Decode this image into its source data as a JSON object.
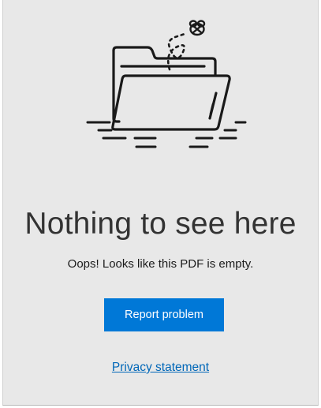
{
  "empty_state": {
    "illustration_icon": "empty-folder-with-bee-icon",
    "title": "Nothing to see here",
    "message": "Oops! Looks like this PDF is empty.",
    "report_button_label": "Report problem",
    "privacy_link_label": "Privacy statement"
  },
  "colors": {
    "background": "#e8e8e8",
    "accent": "#0078d7",
    "link": "#0067b8",
    "title_text": "#333333"
  }
}
